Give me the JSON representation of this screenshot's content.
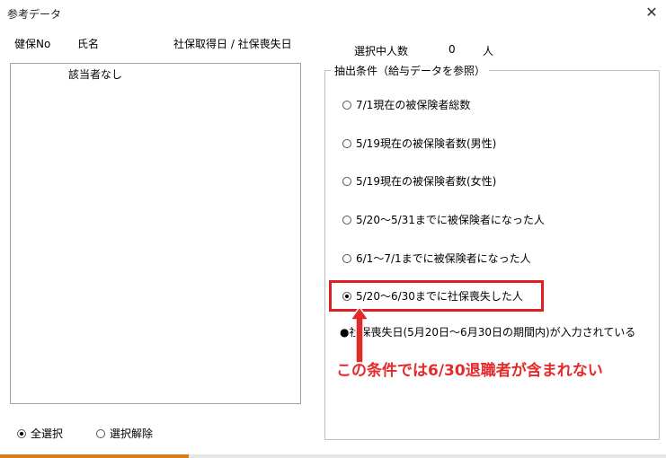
{
  "window": {
    "title": "参考データ"
  },
  "list": {
    "headers": [
      "健保No",
      "氏名",
      "社保取得日 / 社保喪失日"
    ],
    "items": [
      "該当者なし"
    ]
  },
  "selection": {
    "label": "選択中人数",
    "count": "0",
    "unit": "人"
  },
  "conditions": {
    "legend": "抽出条件（給与データを参照）",
    "options": [
      {
        "label": "7/1現在の被保険者総数",
        "selected": false
      },
      {
        "label": "5/19現在の被保険者数(男性)",
        "selected": false
      },
      {
        "label": "5/19現在の被保険者数(女性)",
        "selected": false
      },
      {
        "label": "5/20～5/31までに被保険者になった人",
        "selected": false
      },
      {
        "label": "6/1～7/1までに被保険者になった人",
        "selected": false
      },
      {
        "label": "5/20～6/30までに社保喪失した人",
        "selected": true
      }
    ],
    "note": "●社保喪失日(5月20日～6月30日の期間内)が入力されている"
  },
  "annotation": {
    "text": "この条件では6/30退職者が含まれない",
    "color": "#e52a2a"
  },
  "bottom": {
    "select_all": {
      "label": "全選択",
      "selected": true
    },
    "deselect": {
      "label": "選択解除",
      "selected": false
    }
  }
}
